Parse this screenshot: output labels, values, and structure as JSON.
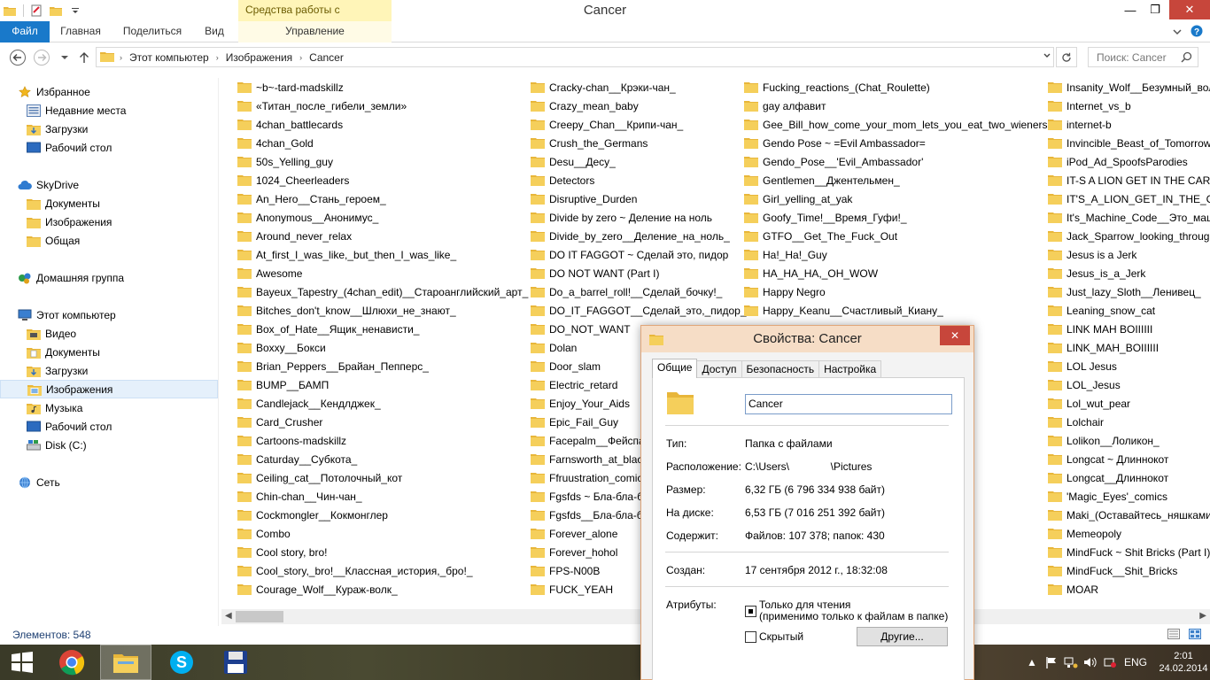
{
  "window": {
    "title": "Cancer",
    "context_tab": "Средства работы с рисунками",
    "minimize": "—",
    "maximize": "❐",
    "close": "✕"
  },
  "ribbon": {
    "tabs": [
      "Файл",
      "Главная",
      "Поделиться",
      "Вид",
      "Управление"
    ],
    "active_tab": "Файл",
    "accent": "#1979ca"
  },
  "address": {
    "crumbs": [
      "Этот компьютер",
      "Изображения",
      "Cancer"
    ],
    "search_placeholder": "Поиск: Cancer"
  },
  "nav": {
    "favorites": "Избранное",
    "favorites_items": [
      "Недавние места",
      "Загрузки",
      "Рабочий стол"
    ],
    "skydrive": "SkyDrive",
    "skydrive_items": [
      "Документы",
      "Изображения",
      "Общая"
    ],
    "homegroup": "Домашняя группа",
    "this_pc": "Этот компьютер",
    "this_pc_items": [
      "Видео",
      "Документы",
      "Загрузки",
      "Изображения",
      "Музыка",
      "Рабочий стол",
      "Disk (C:)"
    ],
    "network": "Сеть",
    "selected": "Изображения"
  },
  "files": {
    "col1": [
      "~b~-tard-madskillz",
      "«Титан_после_гибели_земли»",
      "4chan_battlecards",
      "4chan_Gold",
      "50s_Yelling_guy",
      "1024_Cheerleaders",
      "An_Hero__Стань_героем_",
      "Anonymous__Анонимус_",
      "Around_never_relax",
      "At_first_I_was_like,_but_then_I_was_like_",
      "Awesome",
      "Bayeux_Tapestry_(4chan_edit)__Староанглийский_арт_",
      "Bitches_don't_know__Шлюхи_не_знают_",
      "Box_of_Hate__Ящик_ненависти_",
      "Boxxy__Бокси",
      "Brian_Peppers__Брайан_Пепперс_",
      "BUMP__БАМП",
      "Candlejack__Кендлджек_",
      "Card_Crusher",
      "Cartoons-madskillz",
      "Caturday__Субкота_",
      "Ceiling_cat__Потолочный_кот",
      "Chin-chan__Чин-чан_",
      "Cockmongler__Кокмонглер",
      "Combo",
      "Cool story, bro!",
      "Cool_story,_bro!__Классная_история,_бро!_",
      "Courage_Wolf__Кураж-волк_"
    ],
    "col2": [
      "Cracky-chan__Крэки-чан_",
      "Crazy_mean_baby",
      "Creepy_Chan__Крипи-чан_",
      "Crush_the_Germans",
      "Desu__Десу_",
      "Detectors",
      "Disruptive_Durden",
      "Divide by zero ~ Деление на ноль",
      "Divide_by_zero__Деление_на_ноль_",
      "DO IT FAGGOT ~ Сделай это, пидор",
      "DO NOT WANT (Part I)",
      "Do_a_barrel_roll!__Сделай_бочку!_",
      "DO_IT_FAGGOT__Сделай_это,_пидор_",
      "DO_NOT_WANT",
      "Dolan",
      "Door_slam",
      "Electric_retard",
      "Enjoy_Your_Aids",
      "Epic_Fail_Guy",
      "Facepalm__Фейспал",
      "Farnsworth_at_black",
      "Ffruustration_comic",
      "Fgsfds ~ Бла-бла-бл",
      "Fgsfds__Бла-бла-бл",
      "Forever_alone",
      "Forever_hohol",
      "FPS-N00B",
      "FUCK_YEAH"
    ],
    "col3": [
      "Fucking_reactions_(Chat_Roulette)",
      "gay алфавит",
      "Gee_Bill_how_come_your_mom_lets_you_eat_two_wieners",
      "Gendo Pose ~ =Evil Ambassador=",
      "Gendo_Pose__'Evil_Ambassador'",
      "Gentlemen__Джентельмен_",
      "Girl_yelling_at_yak",
      "Goofy_Time!__Время_Гуфи!_",
      "GTFO__Get_The_Fuck_Out",
      "Ha!_Ha!_Guy",
      "HA_HA_HA,_OH_WOW",
      "Happy Negro",
      "Happy_Keanu__Счастливый_Киану_"
    ],
    "col4": [
      "Insanity_Wolf__Безумный_волк",
      "Internet_vs_b",
      "internet-b",
      "Invincible_Beast_of_Tomorrow",
      "iPod_Ad_SpoofsParodies",
      "IT-S A LION GET IN THE CAR! ~",
      "IT'S_A_LION_GET_IN_THE_CAR!",
      "It's_Machine_Code__Это_маши",
      "Jack_Sparrow_looking_through_",
      "Jesus is a Jerk",
      "Jesus_is_a_Jerk",
      "Just_lazy_Sloth__Ленивец_",
      "Leaning_snow_cat",
      "LINK MAH BOIIIIII",
      "LINK_MAH_BOIIIIII",
      "LOL Jesus",
      "LOL_Jesus",
      "Lol_wut_pear",
      "Lolchair",
      "Lolikon__Лоликон_",
      "Longcat ~ Длиннокот",
      "Longcat__Длиннокот",
      "'Magic_Eyes'_comics",
      "Maki_(Оставайтесь_няшками)",
      "Memeopoly",
      "MindFuck ~ Shit Bricks (Part I)",
      "MindFuck__Shit_Bricks",
      "MOAR"
    ]
  },
  "status": {
    "count": "Элементов: 548"
  },
  "dialog": {
    "title": "Свойства: Cancer",
    "tabs": [
      "Общие",
      "Доступ",
      "Безопасность",
      "Настройка"
    ],
    "active_tab": "Общие",
    "name": "Cancer",
    "type_label": "Тип:",
    "type_value": "Папка с файлами",
    "location_label": "Расположение:",
    "location_value": "C:\\Users\\              \\Pictures",
    "size_label": "Размер:",
    "size_value": "6,32 ГБ (6 796 334 938 байт)",
    "disk_label": "На диске:",
    "disk_value": "6,53 ГБ (7 016 251 392 байт)",
    "contains_label": "Содержит:",
    "contains_value": "Файлов: 107 378; папок: 430",
    "created_label": "Создан:",
    "created_value": "17 сентября 2012 г., 18:32:08",
    "attributes_label": "Атрибуты:",
    "readonly_label_1": "Только для чтения",
    "readonly_label_2": "(применимо только к файлам в папке)",
    "hidden_label": "Скрытый",
    "other_button": "Другие...",
    "close": "✕"
  },
  "taskbar": {
    "lang": "ENG",
    "time": "2:01",
    "date": "24.02.2014"
  }
}
